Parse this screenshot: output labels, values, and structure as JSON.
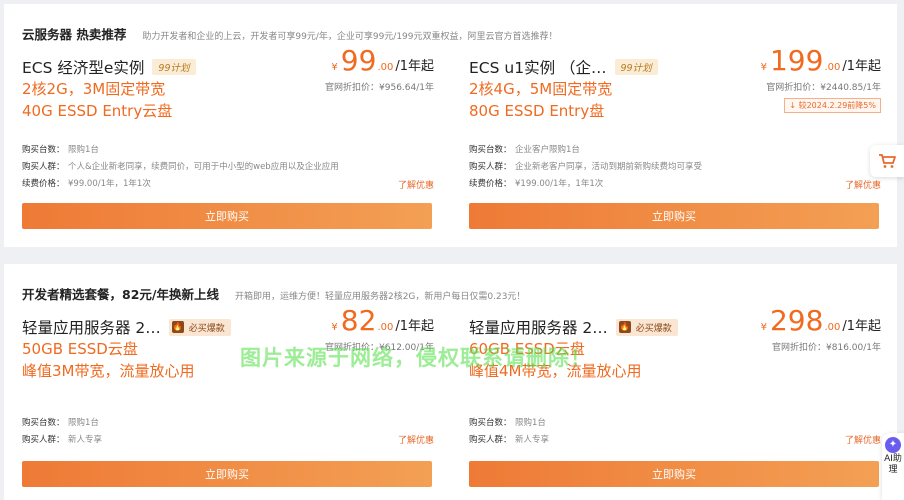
{
  "section1": {
    "title": "云服务器 热卖推荐",
    "desc": "助力开发者和企业的上云，开发者可享99元/年，企业可享99元/199元双重权益，阿里云官方首选推荐！",
    "cards": [
      {
        "name": "ECS 经济型e实例",
        "tag": "99计划",
        "spec1": "2核2G，3M固定带宽",
        "spec2": "40G ESSD Entry云盘",
        "currency": "¥",
        "price_int": "99",
        "price_dec": ".00",
        "unit": "/1年起",
        "orig": "官网折扣价：¥956.64/1年",
        "info": [
          {
            "k": "购买台数：",
            "v": "限购1台"
          },
          {
            "k": "购买人群：",
            "v": "个人&企业新老同享，续费同价，可用于中小型的web应用以及企业应用"
          },
          {
            "k": "续费价格：",
            "v": "¥99.00/1年，1年1次"
          }
        ],
        "more": "了解优惠",
        "buy": "立即购买"
      },
      {
        "name": "ECS u1实例 （企…",
        "tag": "99计划",
        "spec1": "2核4G，5M固定带宽",
        "spec2": "80G ESSD Entry盘",
        "currency": "¥",
        "price_int": "199",
        "price_dec": ".00",
        "unit": "/1年起",
        "orig": "官网折扣价：¥2440.85/1年",
        "badge": "较2024.2.29前降5%",
        "info": [
          {
            "k": "购买台数：",
            "v": "企业客户限购1台"
          },
          {
            "k": "购买人群：",
            "v": "企业新老客户同享，活动到期前新购续费均可享受"
          },
          {
            "k": "续费价格：",
            "v": "¥199.00/1年，1年1次"
          }
        ],
        "more": "了解优惠",
        "buy": "立即购买"
      }
    ]
  },
  "section2": {
    "title": "开发者精选套餐，82元/年换新上线",
    "desc": "开箱即用，运维方便！轻量应用服务器2核2G，新用户每日仅需0.23元！",
    "cards": [
      {
        "name": "轻量应用服务器 2…",
        "tag": "必买爆款",
        "spec1": "50GB ESSD云盘",
        "spec2": "峰值3M带宽，流量放心用",
        "currency": "¥",
        "price_int": "82",
        "price_dec": ".00",
        "unit": "/1年起",
        "orig": "官网折扣价：¥612.00/1年",
        "info": [
          {
            "k": "购买台数：",
            "v": "限购1台"
          },
          {
            "k": "购买人群：",
            "v": "新人专享"
          }
        ],
        "more": "了解优惠",
        "buy": "立即购买"
      },
      {
        "name": "轻量应用服务器 2…",
        "tag": "必买爆款",
        "spec1": "60GB ESSD云盘",
        "spec2": "峰值4M带宽，流量放心用",
        "currency": "¥",
        "price_int": "298",
        "price_dec": ".00",
        "unit": "/1年起",
        "orig": "官网折扣价：¥816.00/1年",
        "info": [
          {
            "k": "购买台数：",
            "v": "限购1台"
          },
          {
            "k": "购买人群：",
            "v": "新人专享"
          }
        ],
        "more": "了解优惠",
        "buy": "立即购买"
      }
    ]
  },
  "float": {
    "cart_icon": "shopping-cart-icon",
    "ai_label": "AI助理"
  },
  "watermark": "图片来源于网络，侵权联系请删除！",
  "colors": {
    "accent": "#f06a1f",
    "button_start": "#ee7a36",
    "button_end": "#f3a054",
    "tag_bg": "#fbecd6"
  }
}
